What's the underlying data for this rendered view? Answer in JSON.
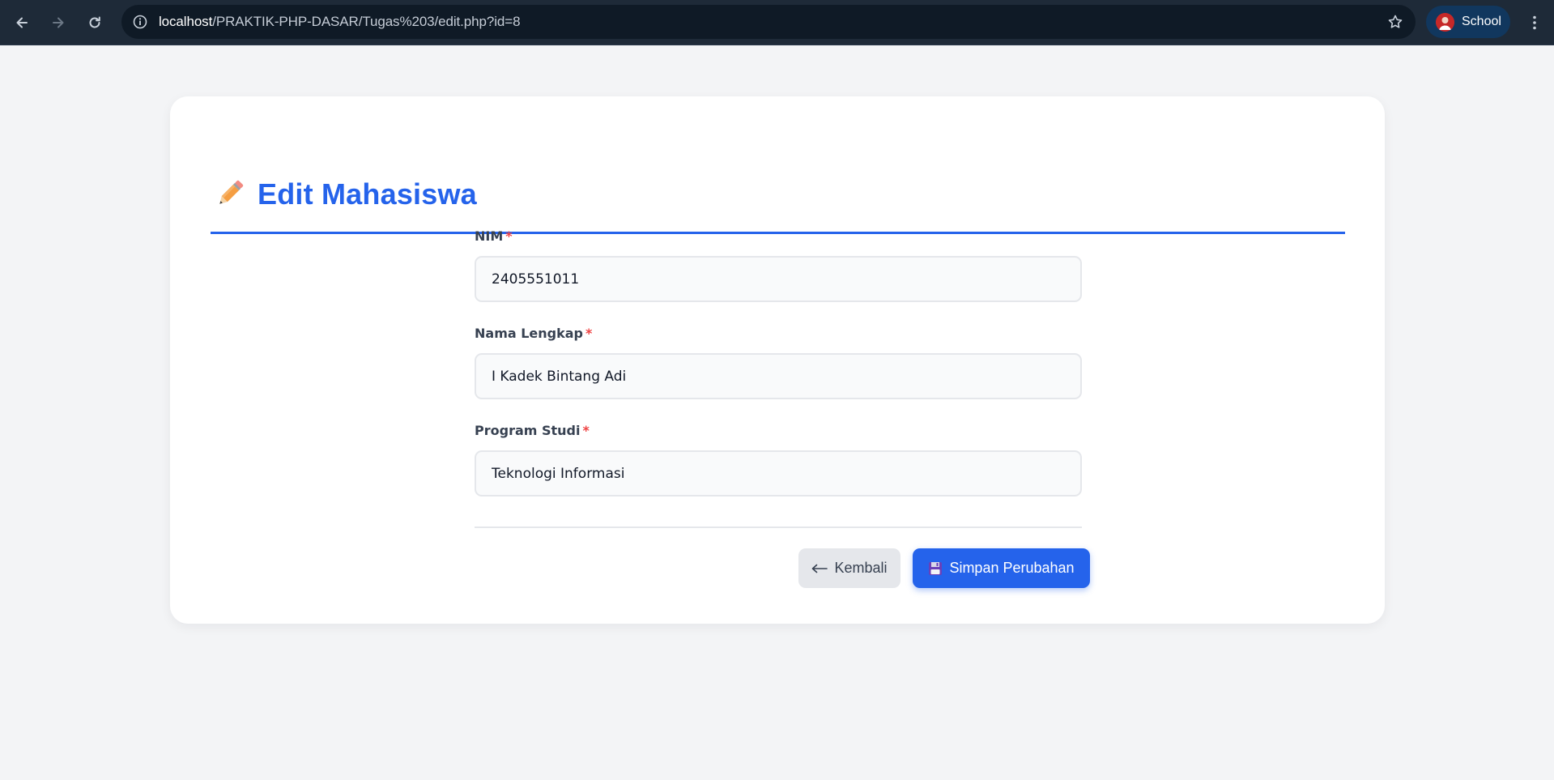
{
  "browser": {
    "url_host": "localhost",
    "url_path": "/PRAKTIK-PHP-DASAR/Tugas%203/edit.php?id=8",
    "profile_label": "School"
  },
  "page": {
    "title": "Edit Mahasiswa",
    "title_icon": "pencil-icon",
    "accent_color": "#2563eb"
  },
  "form": {
    "required_marker": "*",
    "fields": [
      {
        "label": "NIM",
        "value": "2405551011"
      },
      {
        "label": "Nama Lengkap",
        "value": "I Kadek Bintang Adi"
      },
      {
        "label": "Program Studi",
        "value": "Teknologi Informasi"
      }
    ],
    "back_button": {
      "label": "Kembali",
      "icon": "arrow-left-icon"
    },
    "save_button": {
      "label": "Simpan Perubahan",
      "icon": "floppy-disk-icon"
    }
  }
}
